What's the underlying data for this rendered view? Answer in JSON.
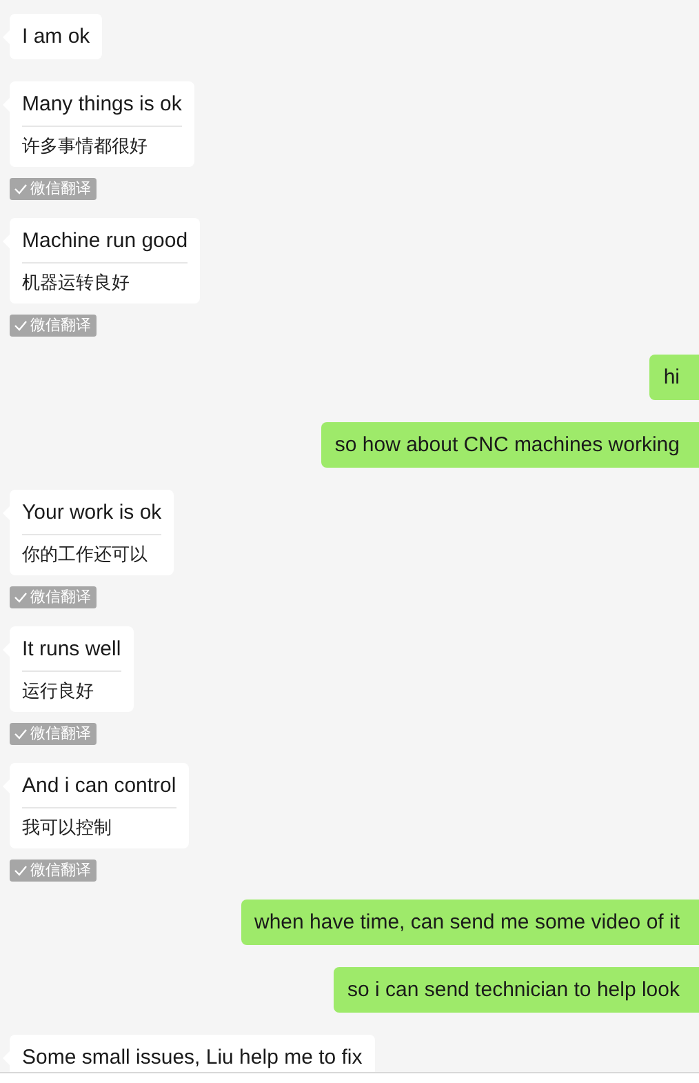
{
  "messages": [
    {
      "kind": "incoming",
      "text": "I am ok"
    },
    {
      "kind": "incoming",
      "text": "Many things is ok",
      "translation": "许多事情都很好",
      "badge": "微信翻译"
    },
    {
      "kind": "incoming",
      "text": "Machine run good",
      "translation": "机器运转良好",
      "badge": "微信翻译"
    },
    {
      "kind": "outgoing",
      "text": "hi"
    },
    {
      "kind": "outgoing",
      "text": "so how about CNC machines working"
    },
    {
      "kind": "incoming",
      "text": "Your work is ok",
      "translation": "你的工作还可以",
      "badge": "微信翻译"
    },
    {
      "kind": "incoming",
      "text": "It runs well",
      "translation": "运行良好",
      "badge": "微信翻译"
    },
    {
      "kind": "incoming",
      "text": "And i can control",
      "translation": "我可以控制",
      "badge": "微信翻译"
    },
    {
      "kind": "outgoing",
      "text": "when have time, can send me some video of it"
    },
    {
      "kind": "outgoing",
      "text": "so i can send technician to help look"
    },
    {
      "kind": "incoming",
      "text": "Some small issues, Liu help me to fix"
    }
  ]
}
